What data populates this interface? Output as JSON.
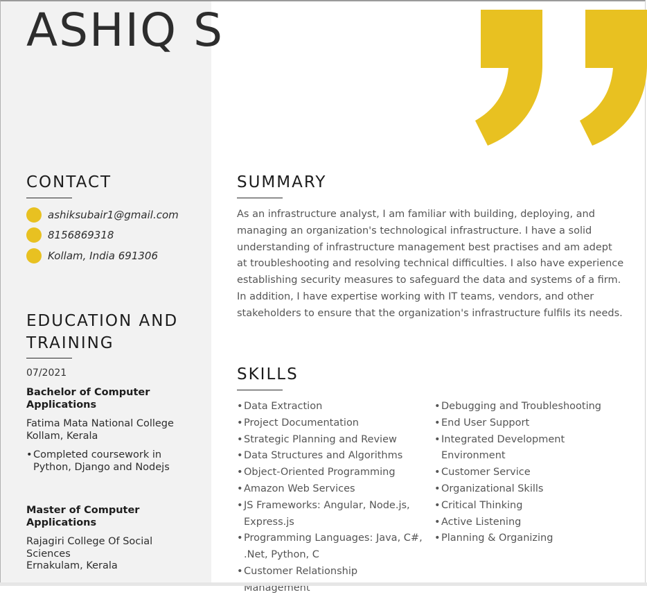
{
  "resume": {
    "name": "ASHIQ S",
    "accent_color": "#e8c121",
    "sidebar_color": "#f2f2f2"
  },
  "contact": {
    "title": "CONTACT",
    "items": [
      {
        "icon": "email-dot-icon",
        "text": "ashiksubair1@gmail.com"
      },
      {
        "icon": "phone-dot-icon",
        "text": "8156869318"
      },
      {
        "icon": "location-dot-icon",
        "text": "Kollam, India 691306"
      }
    ]
  },
  "education": {
    "title_line1": "EDUCATION AND",
    "title_line2": "TRAINING",
    "entries": [
      {
        "date": "07/2021",
        "degree": "Bachelor of Computer Applications",
        "school_lines": [
          "Fatima Mata National College",
          "Kollam, Kerala"
        ],
        "bullet": "Completed coursework in Python, Django and Nodejs"
      },
      {
        "degree": "Master of Computer Applications",
        "school_lines": [
          "Rajagiri College Of Social",
          "Sciences",
          "Ernakulam, Kerala"
        ]
      }
    ]
  },
  "summary": {
    "title": "SUMMARY",
    "text": "As an infrastructure analyst, I am familiar with building, deploying, and managing an organization's technological infrastructure. I have a solid understanding of infrastructure management best practises and am adept at troubleshooting and resolving technical difficulties. I also have experience establishing security measures to safeguard the data and systems of a firm. In addition, I have expertise working with IT teams, vendors, and other stakeholders to ensure that the organization's infrastructure fulfils its needs."
  },
  "skills": {
    "title": "SKILLS",
    "column1": [
      "Data Extraction",
      "Project Documentation",
      "Strategic Planning and Review",
      "Data Structures and Algorithms",
      "Object-Oriented Programming",
      "Amazon Web Services",
      "JS Frameworks: Angular, Node.js, Express.js",
      "Programming Languages: Java, C#, .Net, Python, C",
      "Customer Relationship Management"
    ],
    "column2": [
      "Debugging and Troubleshooting",
      "End User Support",
      "Integrated Development Environment",
      "Customer Service",
      "Organizational Skills",
      "Critical Thinking",
      "Active Listening",
      "Planning & Organizing"
    ]
  }
}
